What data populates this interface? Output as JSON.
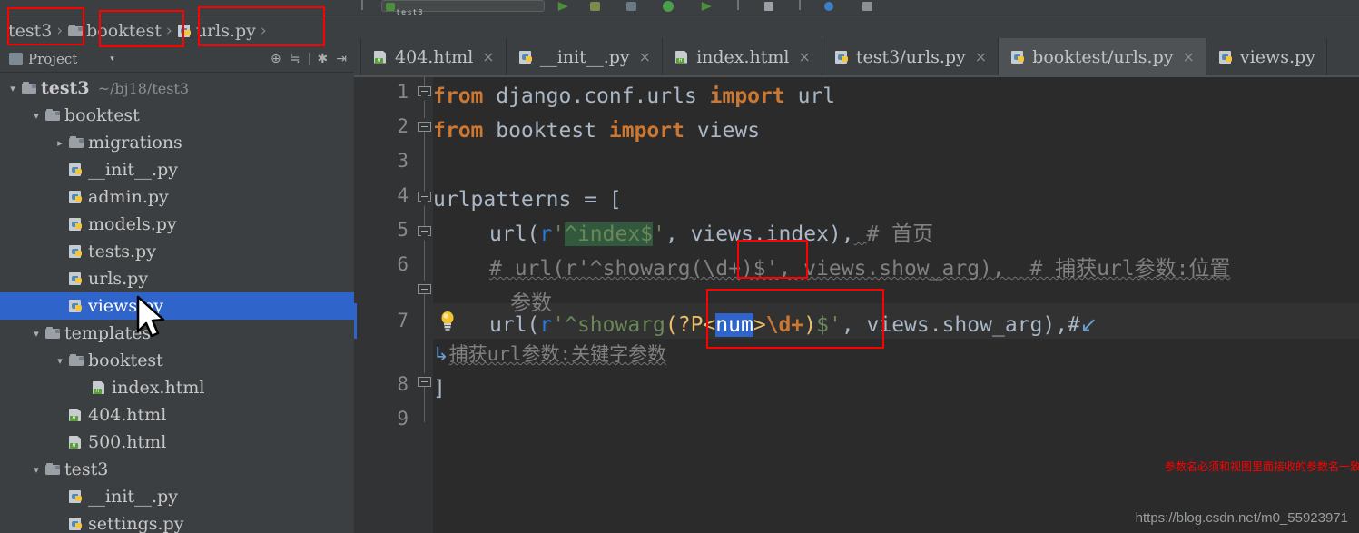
{
  "window": {
    "watermark": "https://blog.csdn.net/m0_55923971"
  },
  "toolbar": {
    "run_config_label": "test3",
    "icons": [
      "run-icon",
      "debug-icon",
      "coverage-icon",
      "profile-icon",
      "attach-icon",
      "search-icon"
    ]
  },
  "breadcrumb": {
    "items": [
      {
        "label": "test3",
        "icon": "none",
        "separator": "›"
      },
      {
        "label": "booktest",
        "icon": "folder-icon",
        "separator": "›"
      },
      {
        "label": "urls.py",
        "icon": "python-file-icon",
        "separator": "›"
      }
    ]
  },
  "project_panel": {
    "title": "Project",
    "caret": "▾",
    "tools": [
      {
        "name": "locate-target-icon",
        "glyph": "⊕"
      },
      {
        "name": "collapse-all-icon",
        "glyph": "≒"
      },
      {
        "name": "settings-gear-icon",
        "glyph": "✱"
      },
      {
        "name": "hide-panel-icon",
        "glyph": "⇥"
      }
    ]
  },
  "tree": [
    {
      "label": "test3",
      "path": "~/bj18/test3",
      "icon": "folder-icon",
      "arrow": "▾",
      "indent": 0,
      "bold": true,
      "selected": false
    },
    {
      "label": "booktest",
      "path": "",
      "icon": "folder-icon",
      "arrow": "▾",
      "indent": 1,
      "bold": false,
      "selected": false
    },
    {
      "label": "migrations",
      "path": "",
      "icon": "folder-icon",
      "arrow": "▸",
      "indent": 2,
      "bold": false,
      "selected": false
    },
    {
      "label": "__init__.py",
      "path": "",
      "icon": "python-file-icon",
      "arrow": "",
      "indent": 2,
      "bold": false,
      "selected": false
    },
    {
      "label": "admin.py",
      "path": "",
      "icon": "python-file-icon",
      "arrow": "",
      "indent": 2,
      "bold": false,
      "selected": false
    },
    {
      "label": "models.py",
      "path": "",
      "icon": "python-file-icon",
      "arrow": "",
      "indent": 2,
      "bold": false,
      "selected": false
    },
    {
      "label": "tests.py",
      "path": "",
      "icon": "python-file-icon",
      "arrow": "",
      "indent": 2,
      "bold": false,
      "selected": false
    },
    {
      "label": "urls.py",
      "path": "",
      "icon": "python-file-icon",
      "arrow": "",
      "indent": 2,
      "bold": false,
      "selected": false
    },
    {
      "label": "views.py",
      "path": "",
      "icon": "python-file-icon",
      "arrow": "",
      "indent": 2,
      "bold": false,
      "selected": true
    },
    {
      "label": "templates",
      "path": "",
      "icon": "folder-icon",
      "arrow": "▾",
      "indent": 1,
      "bold": false,
      "selected": false
    },
    {
      "label": "booktest",
      "path": "",
      "icon": "folder-icon",
      "arrow": "▾",
      "indent": 2,
      "bold": false,
      "selected": false
    },
    {
      "label": "index.html",
      "path": "",
      "icon": "html-file-icon",
      "arrow": "",
      "indent": 3,
      "bold": false,
      "selected": false
    },
    {
      "label": "404.html",
      "path": "",
      "icon": "html-file-icon",
      "arrow": "",
      "indent": 2,
      "bold": false,
      "selected": false
    },
    {
      "label": "500.html",
      "path": "",
      "icon": "html-file-icon",
      "arrow": "",
      "indent": 2,
      "bold": false,
      "selected": false
    },
    {
      "label": "test3",
      "path": "",
      "icon": "folder-icon",
      "arrow": "▾",
      "indent": 1,
      "bold": false,
      "selected": false
    },
    {
      "label": "__init__.py",
      "path": "",
      "icon": "python-file-icon",
      "arrow": "",
      "indent": 2,
      "bold": false,
      "selected": false
    },
    {
      "label": "settings.py",
      "path": "",
      "icon": "python-file-icon",
      "arrow": "",
      "indent": 2,
      "bold": false,
      "selected": false
    }
  ],
  "tabs": [
    {
      "label": "404.html",
      "icon": "html-file-icon",
      "active": false,
      "close": "×"
    },
    {
      "label": "__init__.py",
      "icon": "python-file-icon",
      "active": false,
      "close": "×"
    },
    {
      "label": "index.html",
      "icon": "html-file-icon",
      "active": false,
      "close": "×"
    },
    {
      "label": "test3/urls.py",
      "icon": "python-file-icon",
      "active": false,
      "close": "×"
    },
    {
      "label": "booktest/urls.py",
      "icon": "python-file-icon",
      "active": true,
      "close": "×"
    },
    {
      "label": "views.py",
      "icon": "python-file-icon",
      "active": false,
      "close": ""
    }
  ],
  "editor": {
    "line_numbers": [
      "1",
      "2",
      "3",
      "4",
      "5",
      "6",
      "7",
      "8",
      "9"
    ],
    "lines": {
      "l1_kw_from": "from",
      "l1_module": " django.conf.urls ",
      "l1_kw_import": "import",
      "l1_name": " url",
      "l2_kw_from": "from",
      "l2_module": " booktest ",
      "l2_kw_import": "import",
      "l2_name": " views",
      "l4": "urlpatterns = [",
      "l5_call": "url(",
      "l5_prefix": "r",
      "l5_quote_open": "'",
      "l5_regex": "^index$",
      "l5_quote_close": "'",
      "l5_rest": ", views.index),",
      "l5_comment": "# 首页",
      "l6": "# url(r'^showarg(\\d+)$', views.show_arg),  # 捕获url参数:位置",
      "l6_wrap": "参数",
      "l7_call": "url(",
      "l7_prefix": "r",
      "l7_quote_open": "'",
      "l7_regex_a": "^showarg",
      "l7_group_open": "(?P<",
      "l7_group_name": "num",
      "l7_group_mid": ">",
      "l7_group_d": "\\d+",
      "l7_group_close": ")",
      "l7_regex_b": "$",
      "l7_quote_close": "'",
      "l7_rest": ", views.show_arg),#",
      "l7_wrap_arrow": "↙",
      "l7_wrap_text": "捕获url参数:关键字参数",
      "l8": "]"
    },
    "intention_icon": "lightbulb-icon",
    "current_line": 7
  },
  "annotations": {
    "note_text": "参数名必须和视图里面接收的参数名一致",
    "color": "#ff0000",
    "boxes": [
      {
        "name": "annot-box-crumb-test3"
      },
      {
        "name": "annot-box-crumb-booktest"
      },
      {
        "name": "annot-box-crumb-urlspy"
      },
      {
        "name": "annot-box-positional-group"
      },
      {
        "name": "annot-box-named-group"
      }
    ]
  },
  "colors": {
    "editor_bg": "#2b2b2b",
    "panel_bg": "#3c3f41",
    "selection": "#2f65ca",
    "keyword": "#cc7832",
    "string": "#6a8759",
    "comment": "#808080",
    "regex_group": "#e8bf6a",
    "annotation": "#ff0000"
  }
}
